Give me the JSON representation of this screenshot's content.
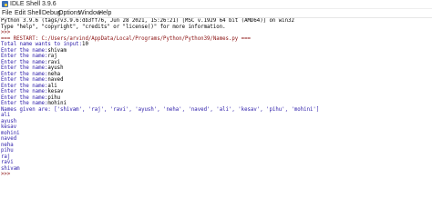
{
  "window": {
    "title": "IDLE Shell 3.9.6"
  },
  "menubar": [
    "File",
    "Edit",
    "Shell",
    "Debug",
    "Options",
    "Window",
    "Help"
  ],
  "shell": {
    "banner": [
      "Python 3.9.6 (tags/v3.9.6:db3ff76, Jun 28 2021, 15:26:21) [MSC v.1929 64 bit (AMD64)] on win32",
      "Type \"help\", \"copyright\", \"credits\" or \"license()\" for more information."
    ],
    "empty_prompt": ">>>",
    "restart": "=== RESTART: C:/Users/arvind/AppData/Local/Programs/Python/Python39/Names.py ===",
    "total_prompt": "Total name wants to input:",
    "total_value": "10",
    "entry_prompt": "Enter the name:",
    "entries": [
      "shivam",
      "raj",
      "ravi",
      "ayush",
      "neha",
      "naved",
      "ali",
      "kesav",
      "pihu",
      "mohini"
    ],
    "names_given": "Names given are: ['shivam', 'raj', 'ravi', 'ayush', 'neha', 'naved', 'ali', 'kesav', 'pihu', 'mohini']",
    "sorted_output": [
      "ali",
      "ayush",
      "kesav",
      "mohini",
      "naved",
      "neha",
      "pihu",
      "raj",
      "ravi",
      "shivam"
    ],
    "final_prompt": ">>>"
  },
  "colors": {
    "stdout": "#2a1aa8",
    "prompt": "#8a1010",
    "error": "#d01010"
  }
}
